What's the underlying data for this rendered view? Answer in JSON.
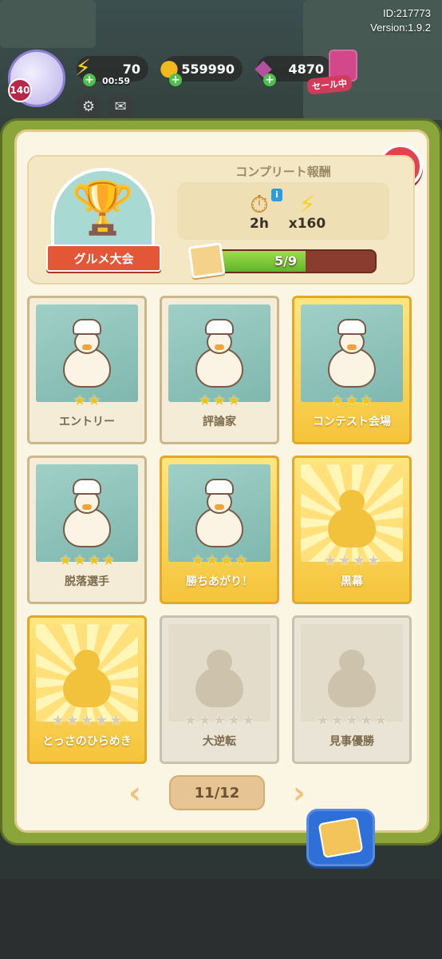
{
  "hud": {
    "id_text": "ID:217773",
    "version_text": "Version:1.9.2",
    "level": "140",
    "energy": "70",
    "energy_timer": "00:59",
    "coins": "559990",
    "gems": "4870",
    "sale_label": "セール中"
  },
  "collection": {
    "category": "グルメ大会",
    "reward_title": "コンプリート報酬",
    "rewards": [
      {
        "icon": "stopwatch-icon",
        "value": "2h"
      },
      {
        "icon": "lightning-icon",
        "value": "x160"
      }
    ],
    "progress_text": "5/9",
    "progress": {
      "collected": 5,
      "total": 9
    }
  },
  "cards": [
    {
      "label": "エントリー",
      "stars": 2,
      "max_stars": 2,
      "state": "collected"
    },
    {
      "label": "評論家",
      "stars": 3,
      "max_stars": 3,
      "state": "collected"
    },
    {
      "label": "コンテスト会場",
      "stars": 3,
      "max_stars": 3,
      "state": "collected-gold"
    },
    {
      "label": "脱落選手",
      "stars": 4,
      "max_stars": 4,
      "state": "collected"
    },
    {
      "label": "勝ちあがり！",
      "stars": 4,
      "max_stars": 4,
      "state": "collected-gold"
    },
    {
      "label": "黒幕",
      "stars": 0,
      "max_stars": 4,
      "state": "locked-gold"
    },
    {
      "label": "とっさのひらめき",
      "stars": 0,
      "max_stars": 5,
      "state": "locked-gold"
    },
    {
      "label": "大逆転",
      "stars": 0,
      "max_stars": 5,
      "state": "locked"
    },
    {
      "label": "見事優勝",
      "stars": 0,
      "max_stars": 5,
      "state": "locked"
    }
  ],
  "pagination": {
    "page_text": "11/12"
  },
  "colors": {
    "accent_green": "#8aa63a",
    "close_red": "#e2434f",
    "gold": "#f2c01a"
  }
}
